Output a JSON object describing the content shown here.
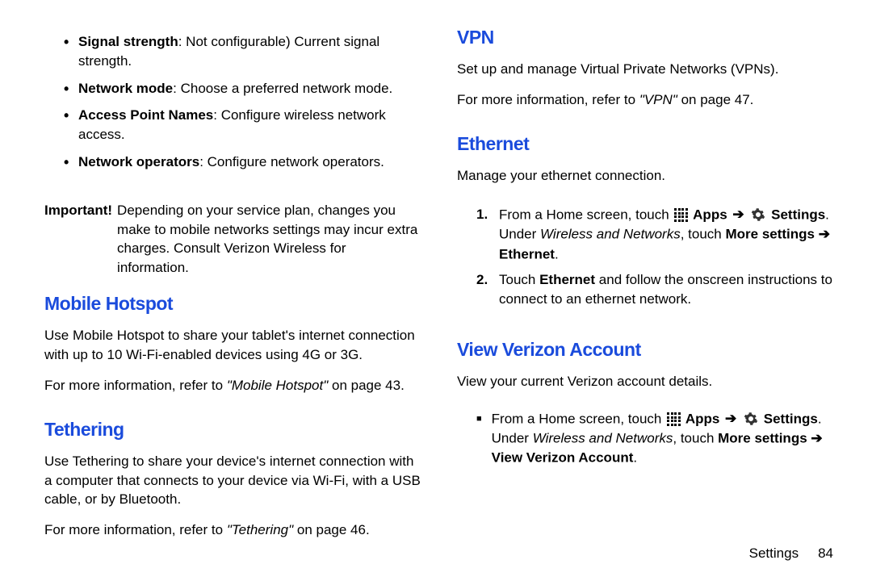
{
  "left": {
    "bullets": [
      {
        "term": "Signal strength",
        "desc": ": Not configurable) Current signal strength."
      },
      {
        "term": "Network mode",
        "desc": ": Choose a preferred network mode."
      },
      {
        "term": "Access Point Names",
        "desc": ": Configure wireless network access."
      },
      {
        "term": "Network operators",
        "desc": ": Configure network operators."
      }
    ],
    "important_label": "Important!",
    "important_text": "Depending on your service plan, changes you make to mobile networks settings may incur extra charges. Consult Verizon Wireless for information.",
    "h_mobile": "Mobile Hotspot",
    "mobile_p": "Use Mobile Hotspot to share your tablet's internet connection with up to 10 Wi-Fi-enabled devices using 4G or 3G.",
    "mobile_ref_pre": "For more information, refer to ",
    "mobile_ref_em": "\"Mobile Hotspot\"",
    "mobile_ref_post": " on page 43.",
    "h_teth": "Tethering",
    "teth_p": "Use Tethering to share your device's internet connection with a computer that connects to your device via Wi-Fi, with a USB cable, or by Bluetooth.",
    "teth_ref_pre": "For more information, refer to ",
    "teth_ref_em": "\"Tethering\"",
    "teth_ref_post": " on page 46."
  },
  "right": {
    "h_vpn": "VPN",
    "vpn_p": "Set up and manage Virtual Private Networks (VPNs).",
    "vpn_ref_pre": "For more information, refer to ",
    "vpn_ref_em": "\"VPN\"",
    "vpn_ref_post": " on page 47.",
    "h_eth": "Ethernet",
    "eth_p": "Manage your ethernet connection.",
    "eth_steps": [
      {
        "num": "1.",
        "pre": "From a Home screen, touch ",
        "apps": "Apps",
        "arr": "➔",
        "settings": "Settings",
        "post1": ". Under ",
        "wire": "Wireless and Networks",
        "post2": ", touch ",
        "more": "More settings ➔ Ethernet",
        "post3": "."
      },
      {
        "num": "2.",
        "text_pre": "Touch ",
        "bold": "Ethernet",
        "text_post": " and follow the onscreen instructions to connect to an ethernet network."
      }
    ],
    "h_vva": "View Verizon Account",
    "vva_p": "View your current Verizon account details.",
    "vva_step": {
      "pre": "From a Home screen, touch ",
      "apps": "Apps",
      "arr": "➔",
      "settings": "Settings",
      "post1": ". Under ",
      "wire": "Wireless and Networks",
      "post2": ", touch ",
      "more": "More settings ➔ View Verizon Account",
      "post3": "."
    }
  },
  "footer": {
    "label": "Settings",
    "page": "84"
  }
}
